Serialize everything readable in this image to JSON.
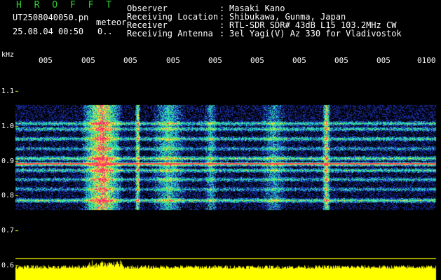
{
  "app": {
    "logo": "H R O F F T",
    "filename": "UT2508040050.pn",
    "event_label": "meteor",
    "datetime": "25.08.04 00:50",
    "count": "0.."
  },
  "info": [
    {
      "label": "Observer",
      "value": "Masaki Kano"
    },
    {
      "label": "Receiving Location",
      "value": "Shibukawa, Gunma, Japan"
    },
    {
      "label": "Receiver",
      "value": "RTL-SDR SDR# 43dB L15 103.2MHz CW"
    },
    {
      "label": "Receiving Antenna",
      "value": "3el Yagi(V) Az 330 for Vladivostok"
    }
  ],
  "colon": ":",
  "axis": {
    "unit": "kHz",
    "y_ticks": [
      "1.1",
      "1.0",
      "0.9",
      "0.8",
      "0.7",
      "0.6"
    ],
    "x_ticks": [
      "005",
      "005",
      "005",
      "005",
      "005",
      "005",
      "005",
      "005",
      "005",
      "0100"
    ]
  },
  "colors": {
    "background": "#000000",
    "logo": "#2fd12f",
    "signal_low": "#1b2fa8",
    "signal_mid": "#2ad0d0",
    "signal_high": "#ff2a6a",
    "amplitude": "#ffff00",
    "grid": "#ffff00"
  }
}
